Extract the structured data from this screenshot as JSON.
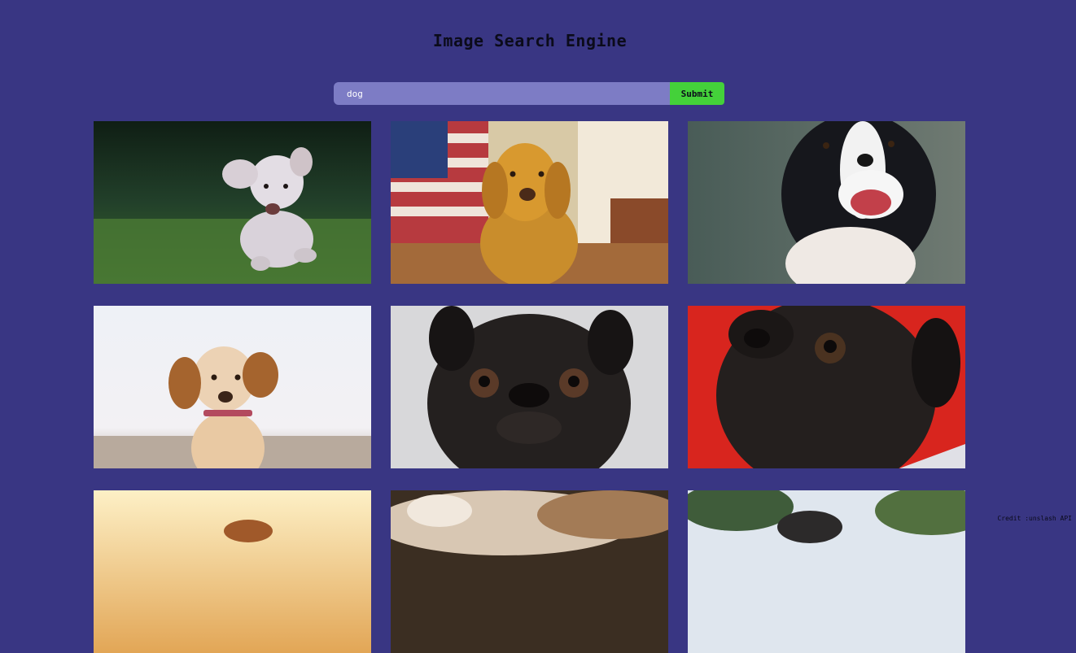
{
  "header": {
    "title": "Image Search Engine"
  },
  "search": {
    "value": "dog",
    "submit_label": "Submit"
  },
  "results": [
    {
      "subject": "white poodle running on grass"
    },
    {
      "subject": "golden retriever with flag"
    },
    {
      "subject": "border collie"
    },
    {
      "subject": "cocker spaniel on beach"
    },
    {
      "subject": "black pug grey background"
    },
    {
      "subject": "black pug red background"
    },
    {
      "subject": "golden dog at sunset"
    },
    {
      "subject": "tabby fur close-up"
    },
    {
      "subject": "dog under trees"
    }
  ],
  "footer": {
    "credit": "Credit :unslash API"
  }
}
